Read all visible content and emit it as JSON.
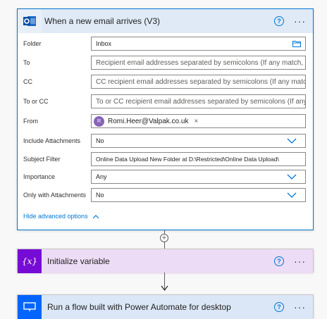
{
  "trigger": {
    "title": "When a new email arrives (V3)",
    "help_icon": "?",
    "more_icon": "···",
    "fields": {
      "folder": {
        "label": "Folder",
        "value": "Inbox"
      },
      "to": {
        "label": "To",
        "placeholder": "Recipient email addresses separated by semicolons (If any match, the"
      },
      "cc": {
        "label": "CC",
        "placeholder": "CC recipient email addresses separated by semicolons (If any match,"
      },
      "to_or_cc": {
        "label": "To or CC",
        "placeholder": "To or CC recipient email addresses separated by semicolons (If any m"
      },
      "from": {
        "label": "From",
        "avatar": "R",
        "value": "Romi.Heer@Valpak.co.uk",
        "remove": "×"
      },
      "include_attachments": {
        "label": "Include Attachments",
        "value": "No"
      },
      "subject_filter": {
        "label": "Subject Filter",
        "value": "Online Data Upload New Folder at D:\\Restricted\\Online Data Upload\\"
      },
      "importance": {
        "label": "Importance",
        "value": "Any"
      },
      "only_with_attachments": {
        "label": "Only with Attachments",
        "value": "No"
      }
    },
    "advanced_link": "Hide advanced options"
  },
  "connector": {
    "add_symbol": "+"
  },
  "variable_action": {
    "title": "Initialize variable",
    "icon_text": "{x}",
    "help_icon": "?",
    "more_icon": "···"
  },
  "flow_action": {
    "title": "Run a flow built with Power Automate for desktop",
    "help_icon": "?",
    "more_icon": "···"
  },
  "colors": {
    "accent": "#0078d4",
    "variable": "#770bd6",
    "desktop_flow": "#0066ff"
  }
}
